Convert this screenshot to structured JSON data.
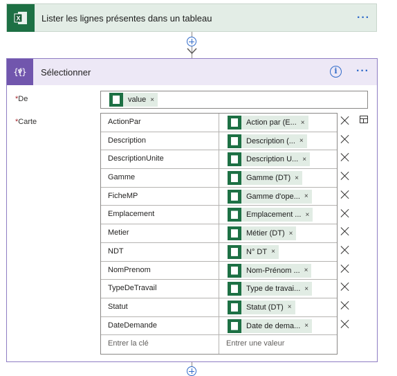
{
  "top_action": {
    "title": "Lister les lignes présentes dans un tableau",
    "icon": "excel-icon",
    "accent": "#1d7044"
  },
  "select_action": {
    "title": "Sélectionner",
    "icon": "data-operation-icon",
    "accent": "#7156ad",
    "info": "i",
    "more": "···",
    "from_label": "De",
    "from_token": "value",
    "map_label": "Carte",
    "required_mark": "*",
    "rows": [
      {
        "key": "ActionPar",
        "value": "Action par (E..."
      },
      {
        "key": "Description",
        "value": "Description (..."
      },
      {
        "key": "DescriptionUnite",
        "value": "Description U..."
      },
      {
        "key": "Gamme",
        "value": "Gamme (DT)"
      },
      {
        "key": "FicheMP",
        "value": "Gamme d'ope..."
      },
      {
        "key": "Emplacement",
        "value": "Emplacement ..."
      },
      {
        "key": "Metier",
        "value": "Métier (DT)"
      },
      {
        "key": "NDT",
        "value": "N° DT"
      },
      {
        "key": "NomPrenom",
        "value": "Nom-Prénom ..."
      },
      {
        "key": "TypeDeTravail",
        "value": "Type de travai..."
      },
      {
        "key": "Statut",
        "value": "Statut (DT)"
      },
      {
        "key": "DateDemande",
        "value": "Date de dema..."
      }
    ],
    "key_placeholder": "Entrer la clé",
    "value_placeholder": "Entrer une valeur"
  },
  "token_close": "×",
  "colors": {
    "excel_green": "#1d7044",
    "token_bg": "#e1ece4",
    "select_purple": "#7156ad",
    "link_blue": "#2f6ac9"
  }
}
